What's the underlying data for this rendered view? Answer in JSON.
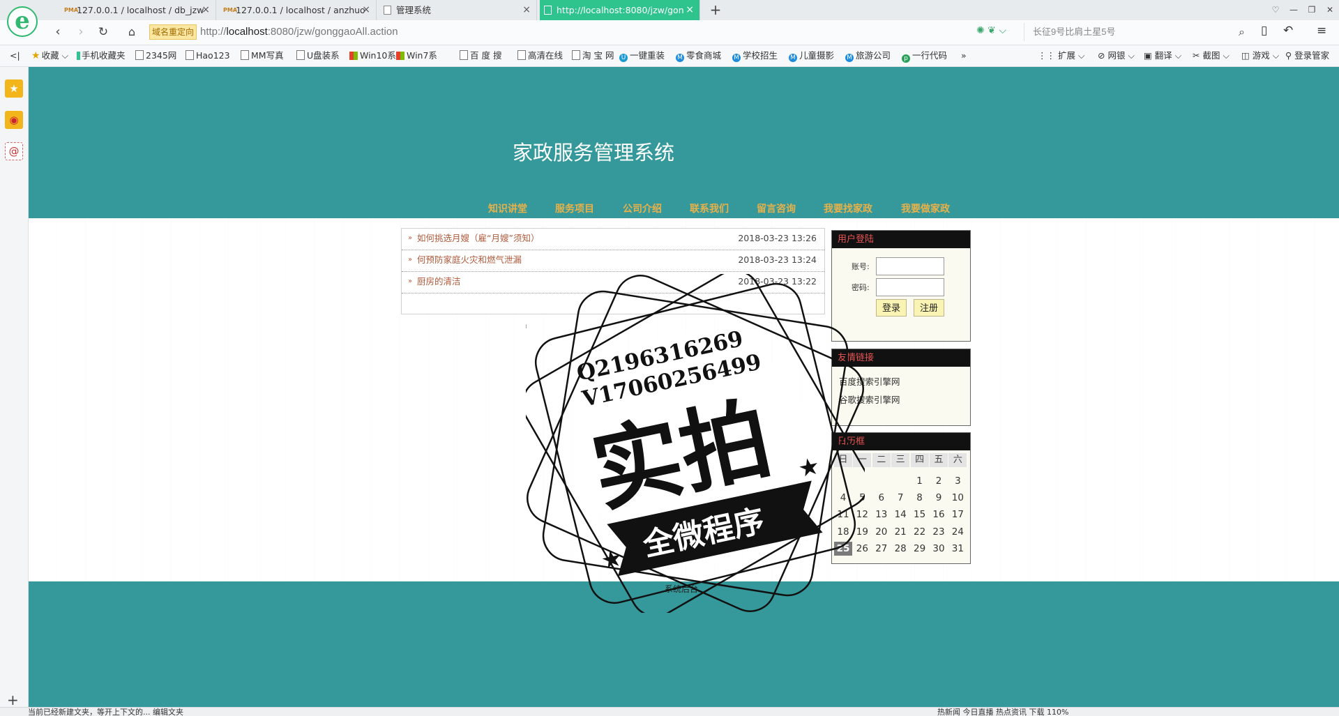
{
  "browser": {
    "tabs": [
      {
        "label": "127.0.0.1 / localhost / db_jzw",
        "favicon": "PMA"
      },
      {
        "label": "127.0.0.1 / localhost / anzhuo",
        "favicon": "PMA"
      },
      {
        "label": "管理系统",
        "favicon": "page"
      },
      {
        "label": "http://localhost:8080/jzw/gon",
        "favicon": "page"
      }
    ],
    "redirect_badge": "域名重定向",
    "url_prefix": "http://",
    "url_host": "localhost",
    "url_rest": ":8080/jzw/gonggaoAll.action",
    "search_placeholder": "长征9号比肩土星5号",
    "bookmarks": [
      "收藏",
      "手机收藏夹",
      "2345网",
      "Hao123",
      "MM写真",
      "U盘装系",
      "Win10系",
      "Win7系",
      "百 度 搜",
      "高清在线",
      "淘 宝 网",
      "一键重装",
      "零食商城",
      "学校招生",
      "儿童摄影",
      "旅游公司",
      "一行代码"
    ],
    "bookmarks_more": "»",
    "toolbar_right": [
      "扩展",
      "网银",
      "翻译",
      "截图",
      "游戏",
      "登录管家"
    ],
    "status_text": "当前已经新建文夹，等开上下文的... 编辑文夹",
    "status_right": "热新闻   今日直播   热点资讯                                     下载           110%"
  },
  "site": {
    "title": "家政服务管理系统",
    "nav": [
      "知识讲堂",
      "服务项目",
      "公司介绍",
      "联系我们",
      "留言咨询",
      "我要找家政",
      "我要做家政"
    ],
    "notices": [
      {
        "title": "如何挑选月嫂（雇“月嫂”须知）",
        "date": "2018-03-23 13:26"
      },
      {
        "title": "何预防家庭火灾和燃气泄漏",
        "date": "2018-03-23 13:24"
      },
      {
        "title": "厨房的清洁",
        "date": "2018-03-23 13:22"
      }
    ],
    "login": {
      "heading": "用户登陆",
      "account_label": "账号:",
      "password_label": "密码:",
      "account_value": "",
      "password_value": "",
      "login_button": "登录",
      "register_button": "注册"
    },
    "links": {
      "heading": "友情链接",
      "items": [
        "百度搜索引擎网",
        "谷歌搜索引擎网"
      ]
    },
    "calendar": {
      "heading": "日历框",
      "weekdays": [
        "日",
        "一",
        "二",
        "三",
        "四",
        "五",
        "六"
      ],
      "first_weekday": 4,
      "days_in_month": 31,
      "today": 25
    },
    "footer_link": "系统后台"
  },
  "stamp": {
    "line1": "Q2196316269",
    "line2": "V17060256499",
    "main": "实拍",
    "banner": "全微程序"
  }
}
